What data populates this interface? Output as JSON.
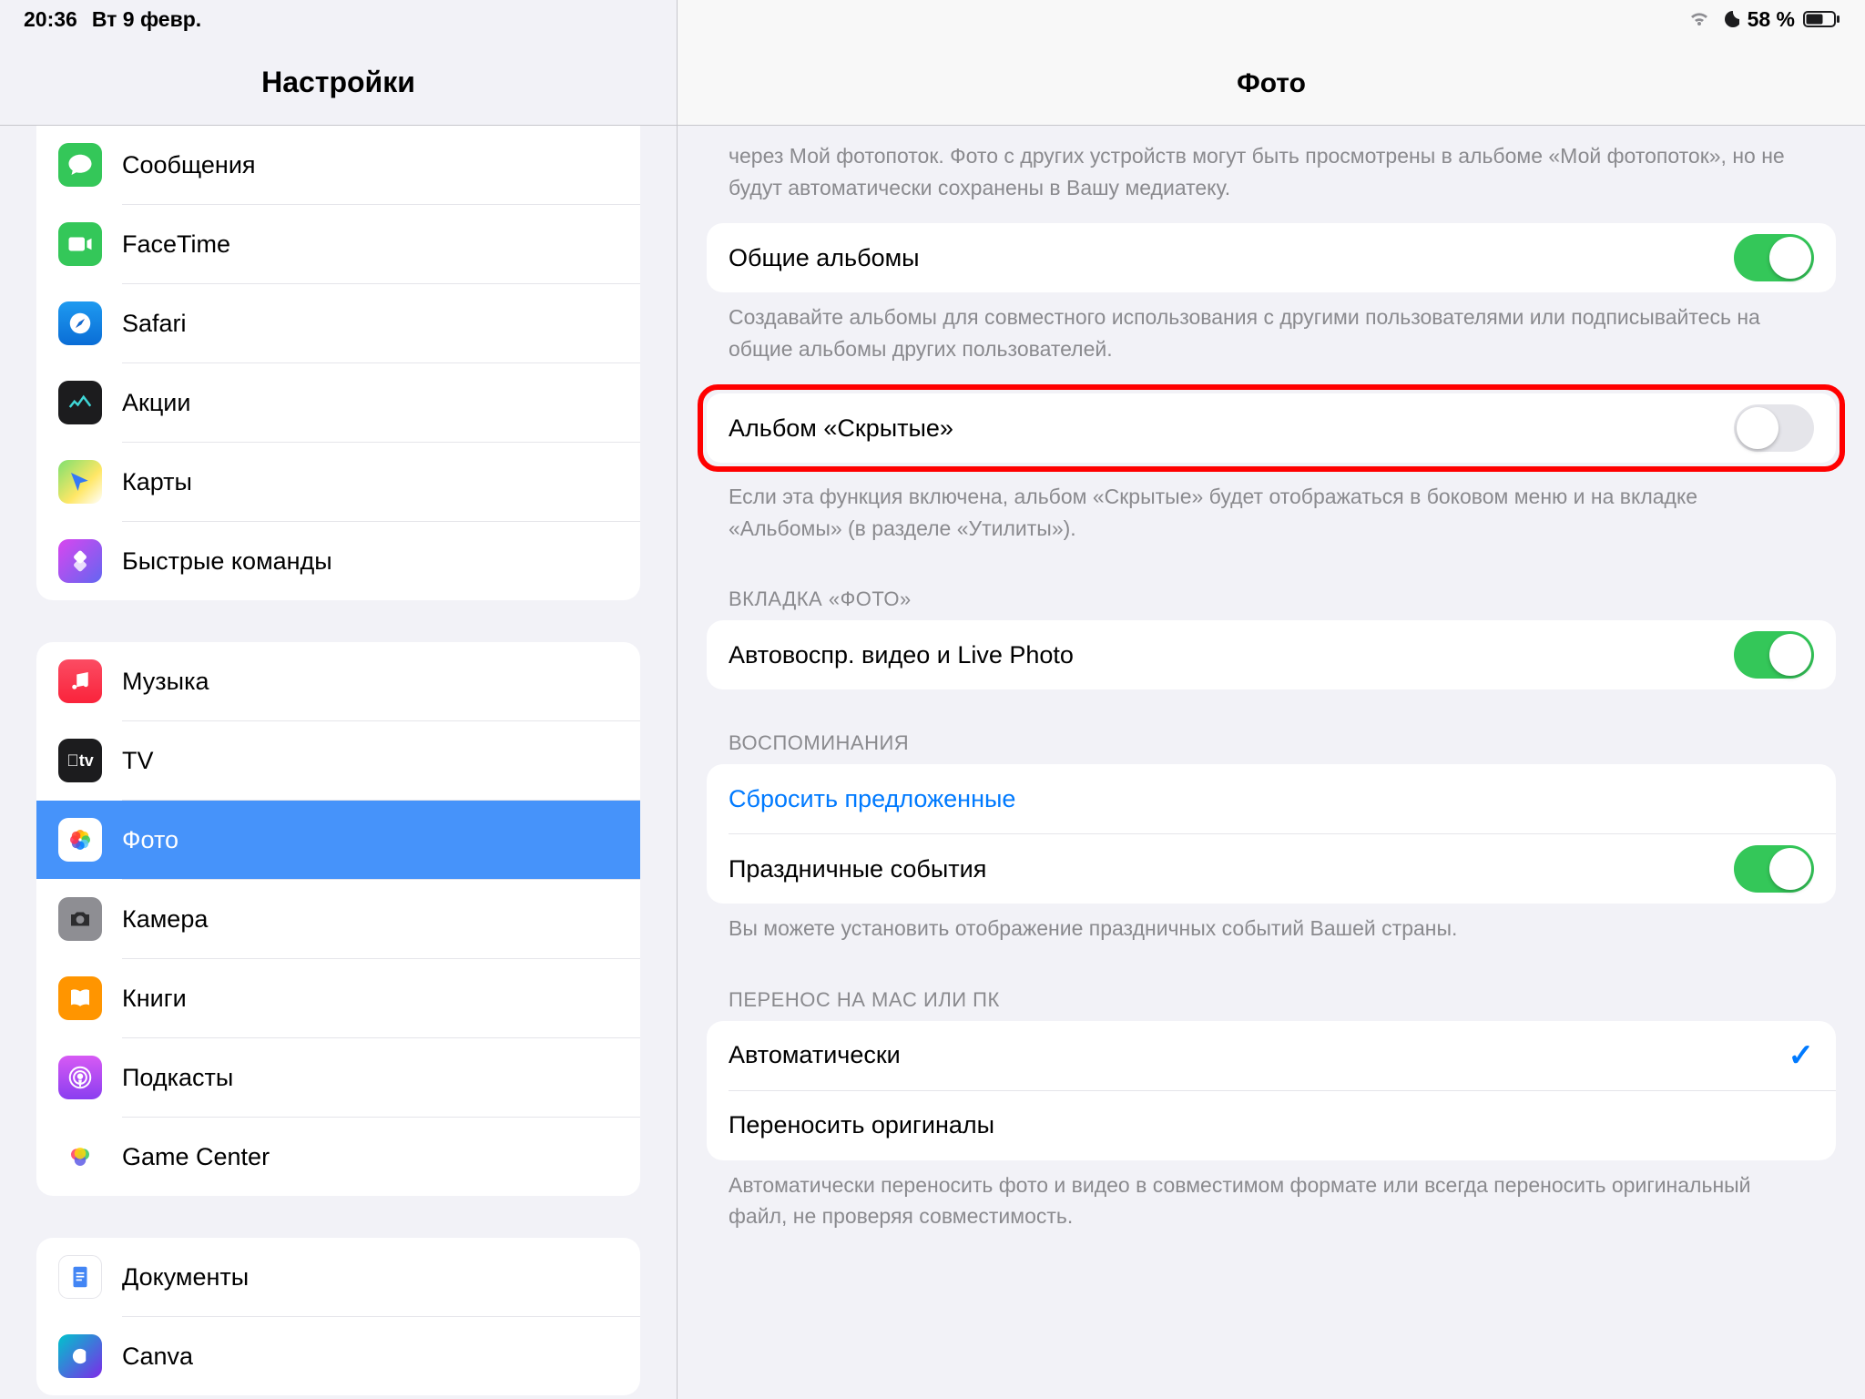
{
  "status": {
    "time": "20:36",
    "date": "Вт 9 февр.",
    "battery": "58 %"
  },
  "sidebar": {
    "title": "Настройки",
    "g1": [
      {
        "k": "messages",
        "label": "Сообщения"
      },
      {
        "k": "facetime",
        "label": "FaceTime"
      },
      {
        "k": "safari",
        "label": "Safari"
      },
      {
        "k": "stocks",
        "label": "Акции"
      },
      {
        "k": "maps",
        "label": "Карты"
      },
      {
        "k": "shortcuts",
        "label": "Быстрые команды"
      }
    ],
    "g2": [
      {
        "k": "music",
        "label": "Музыка"
      },
      {
        "k": "tv",
        "label": "TV"
      },
      {
        "k": "photos",
        "label": "Фото",
        "selected": true
      },
      {
        "k": "camera",
        "label": "Камера"
      },
      {
        "k": "books",
        "label": "Книги"
      },
      {
        "k": "podcasts",
        "label": "Подкасты"
      },
      {
        "k": "gamecenter",
        "label": "Game Center"
      }
    ],
    "g3": [
      {
        "k": "docs",
        "label": "Документы"
      },
      {
        "k": "canva",
        "label": "Canva"
      }
    ]
  },
  "detail": {
    "title": "Фото",
    "intro_footer": "через Мой фотопоток. Фото с других устройств могут быть просмотрены в альбоме «Мой фотопоток», но не будут автоматически сохранены в Вашу медиатеку.",
    "shared_albums_label": "Общие альбомы",
    "shared_albums_footer": "Создавайте альбомы для совместного использования с другими пользователями или подписывайтесь на общие альбомы других пользователей.",
    "hidden_album_label": "Альбом «Скрытые»",
    "hidden_album_footer": "Если эта функция включена, альбом «Скрытые» будет отображаться в боковом меню и на вкладке «Альбомы» (в разделе «Утилиты»).",
    "photos_tab_header": "ВКЛАДКА «ФОТО»",
    "autoplay_label": "Автовоспр. видео и Live Photo",
    "memories_header": "ВОСПОМИНАНИЯ",
    "reset_suggested_label": "Сбросить предложенные",
    "holiday_label": "Праздничные события",
    "memories_footer": "Вы можете установить отображение праздничных событий Вашей страны.",
    "transfer_header": "ПЕРЕНОС НА MAC ИЛИ ПК",
    "transfer_auto_label": "Автоматически",
    "transfer_orig_label": "Переносить оригиналы",
    "transfer_footer": "Автоматически переносить фото и видео в совместимом формате или всегда переносить оригинальный файл, не проверяя совместимость."
  }
}
